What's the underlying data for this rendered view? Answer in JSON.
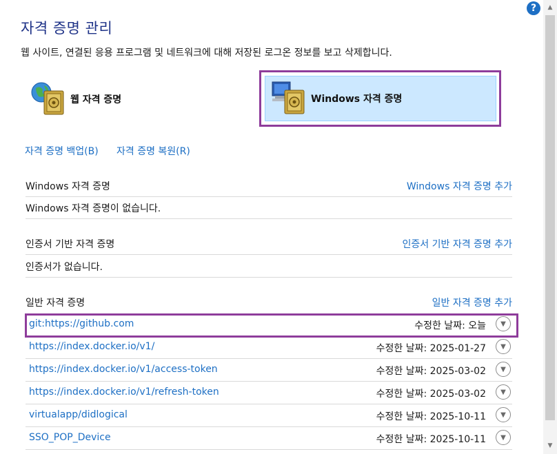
{
  "header": {
    "title": "자격 증명 관리",
    "subtitle": "웹 사이트, 연결된 응용 프로그램 및 네트워크에 대해 저장된 로그온 정보를 보고 삭제합니다.",
    "help_label": "?"
  },
  "vaults": {
    "web": {
      "label": "웹 자격 증명"
    },
    "windows": {
      "label": "Windows 자격 증명",
      "selected": true
    }
  },
  "actions": {
    "backup": "자격 증명 백업(B)",
    "restore": "자격 증명 복원(R)"
  },
  "sections": {
    "windows": {
      "heading": "Windows 자격 증명",
      "add": "Windows 자격 증명 추가",
      "empty": "Windows 자격 증명이 없습니다."
    },
    "certificate": {
      "heading": "인증서 기반 자격 증명",
      "add": "인증서 기반 자격 증명 추가",
      "empty": "인증서가 없습니다."
    },
    "generic": {
      "heading": "일반 자격 증명",
      "add": "일반 자격 증명 추가",
      "items": [
        {
          "name": "git:https://github.com",
          "modified": "수정한 날짜:  오늘"
        },
        {
          "name": "https://index.docker.io/v1/",
          "modified": "수정한 날짜:  2025-01-27"
        },
        {
          "name": "https://index.docker.io/v1/access-token",
          "modified": "수정한 날짜:  2025-03-02"
        },
        {
          "name": "https://index.docker.io/v1/refresh-token",
          "modified": "수정한 날짜:  2025-03-02"
        },
        {
          "name": "virtualapp/didlogical",
          "modified": "수정한 날짜:  2025-10-11"
        },
        {
          "name": "SSO_POP_Device",
          "modified": "수정한 날짜:  2025-10-11"
        }
      ]
    }
  },
  "colors": {
    "link": "#1d6fc4",
    "title": "#1e3287",
    "highlight": "#8e3c9b",
    "selected_bg": "#cce8ff"
  }
}
